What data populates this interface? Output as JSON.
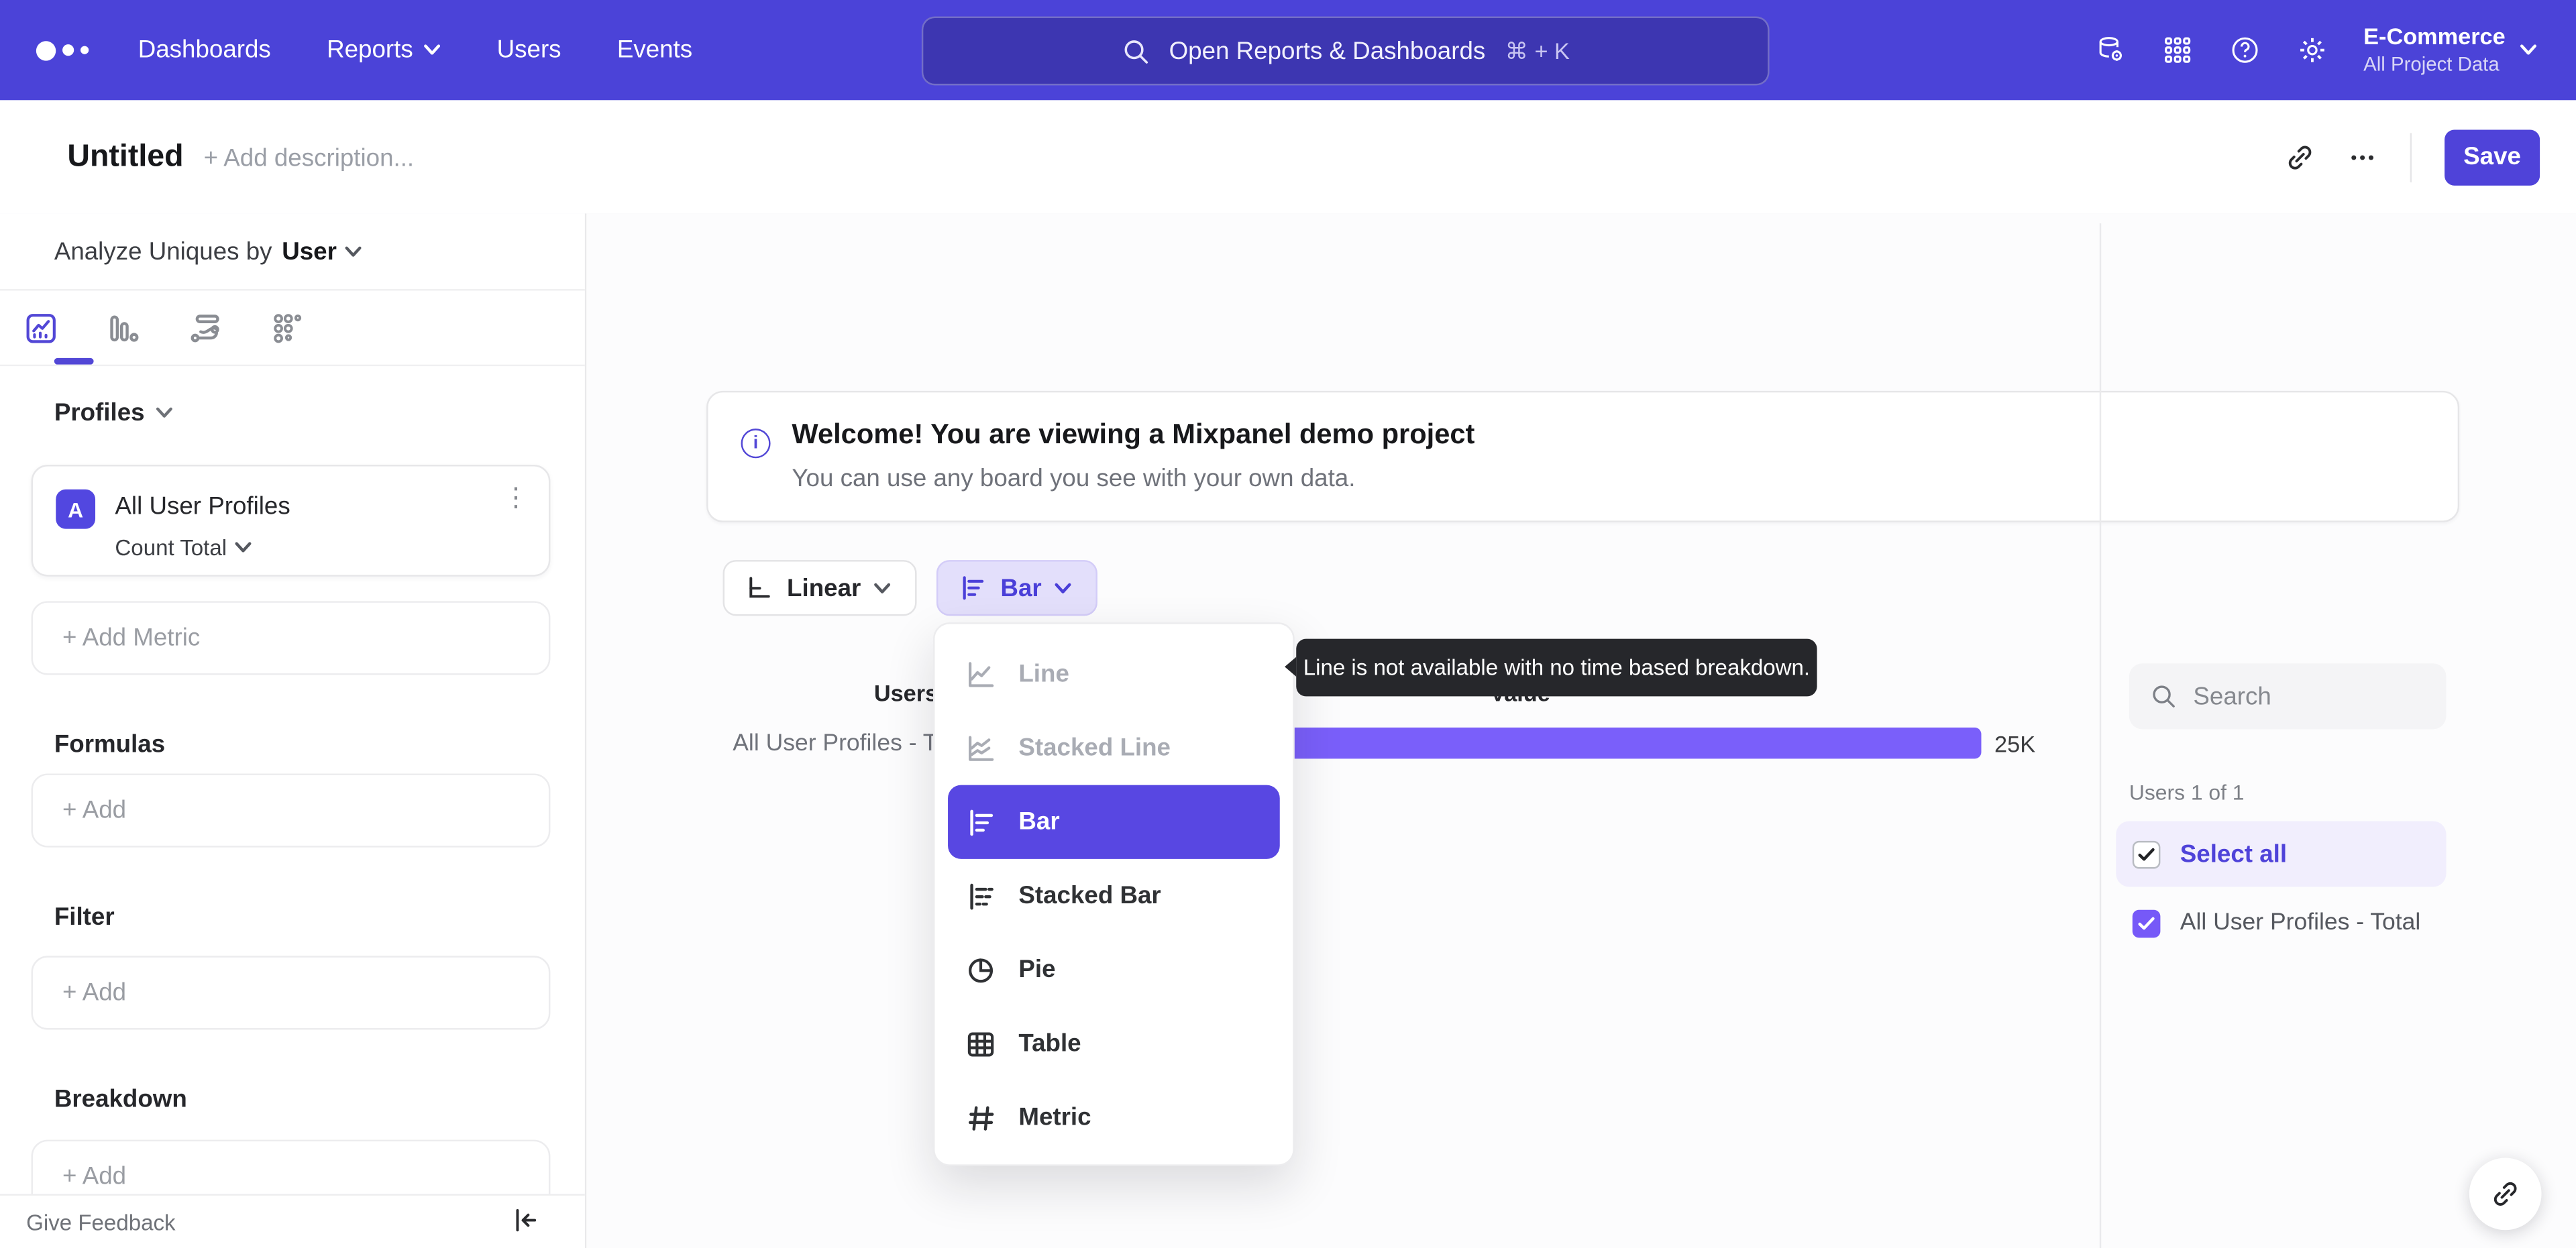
{
  "nav": {
    "items": [
      "Dashboards",
      "Reports",
      "Users",
      "Events"
    ],
    "search_placeholder": "Open Reports & Dashboards",
    "search_shortcut": "⌘ + K",
    "project_name": "E-Commerce",
    "project_scope": "All Project Data",
    "nav_background": "#4b43d8"
  },
  "header": {
    "title": "Untitled",
    "description_placeholder": "+ Add description...",
    "save_label": "Save"
  },
  "sidebar": {
    "analyze_label": "Analyze Uniques by",
    "analyze_value": "User",
    "profiles_heading": "Profiles",
    "metric": {
      "badge": "A",
      "name": "All User Profiles",
      "aggregation": "Count Total"
    },
    "add_metric_label": "+ Add Metric",
    "formulas_heading": "Formulas",
    "filter_heading": "Filter",
    "breakdown_heading": "Breakdown",
    "add_label": "+ Add",
    "feedback_label": "Give Feedback"
  },
  "banner": {
    "title": "Welcome! You are viewing a Mixpanel demo project",
    "subtitle": "You can use any board you see with your own data."
  },
  "controls": {
    "scale_label": "Linear",
    "chart_type_label": "Bar"
  },
  "menu": {
    "items": [
      {
        "label": "Line",
        "state": "disabled"
      },
      {
        "label": "Stacked Line",
        "state": "disabled"
      },
      {
        "label": "Bar",
        "state": "selected"
      },
      {
        "label": "Stacked Bar",
        "state": "normal"
      },
      {
        "label": "Pie",
        "state": "normal"
      },
      {
        "label": "Table",
        "state": "normal"
      },
      {
        "label": "Metric",
        "state": "normal"
      }
    ]
  },
  "tooltip": {
    "text": "Line is not available with no time based breakdown."
  },
  "chart_data": {
    "type": "bar",
    "orientation": "horizontal",
    "col_headers": [
      "Users",
      "Value"
    ],
    "categories": [
      "All User Profiles - Total"
    ],
    "series": [
      {
        "name": "All User Profiles - Total",
        "values": [
          25000
        ]
      }
    ],
    "value_labels": [
      "25K"
    ],
    "bar_color": "#7a5ffa",
    "grid": false,
    "legend": false
  },
  "right_panel": {
    "search_placeholder": "Search",
    "count_label": "Users 1 of 1",
    "select_all_label": "Select all",
    "items": [
      {
        "label": "All User Profiles - Total",
        "checked": true
      }
    ]
  },
  "colors": {
    "accent": "#4f43d9",
    "menu_selected": "#5847e2",
    "bar": "#7a5ffa",
    "checkbox_checked": "#7659f8",
    "tooltip_bg": "#26272b",
    "select_all_bg": "#f1eefd"
  }
}
